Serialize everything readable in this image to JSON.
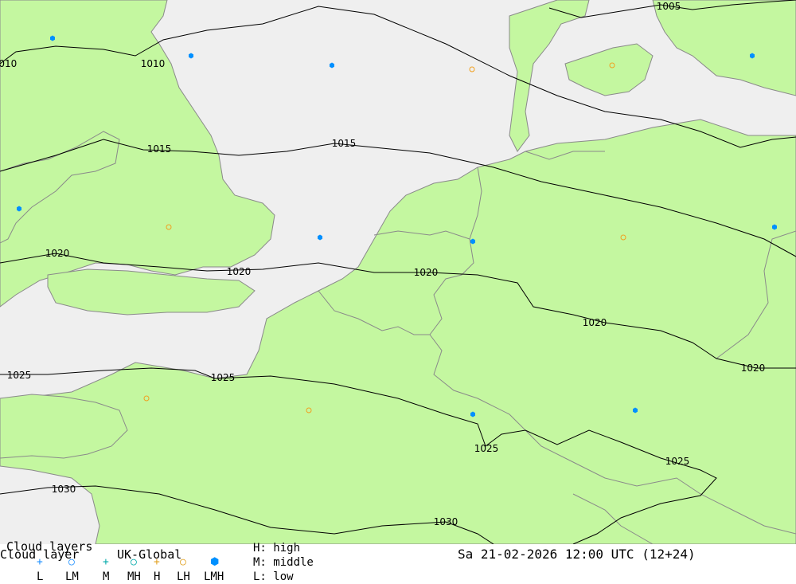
{
  "map": {
    "isobars": [
      {
        "value": "1010",
        "label": "1010",
        "points": [
          [
            0,
            80
          ],
          [
            20,
            65
          ],
          [
            70,
            58
          ],
          [
            130,
            62
          ],
          [
            170,
            70
          ],
          [
            205,
            50
          ],
          [
            260,
            38
          ],
          [
            330,
            30
          ],
          [
            400,
            8
          ],
          [
            470,
            18
          ],
          [
            560,
            55
          ],
          [
            640,
            95
          ],
          [
            700,
            120
          ],
          [
            760,
            140
          ],
          [
            830,
            150
          ],
          [
            880,
            165
          ],
          [
            930,
            185
          ],
          [
            970,
            175
          ],
          [
            1000,
            172
          ]
        ]
      },
      {
        "value": "1005",
        "label": "1005",
        "points": [
          [
            690,
            10
          ],
          [
            730,
            22
          ],
          [
            780,
            14
          ],
          [
            830,
            6
          ],
          [
            870,
            12
          ],
          [
            920,
            6
          ],
          [
            970,
            2
          ],
          [
            1000,
            0
          ]
        ]
      },
      {
        "value": "1015",
        "label": "1015",
        "points": [
          [
            0,
            215
          ],
          [
            70,
            195
          ],
          [
            130,
            175
          ],
          [
            180,
            188
          ],
          [
            240,
            190
          ],
          [
            300,
            195
          ],
          [
            360,
            190
          ],
          [
            420,
            180
          ],
          [
            470,
            185
          ],
          [
            540,
            192
          ],
          [
            620,
            210
          ],
          [
            680,
            228
          ],
          [
            760,
            245
          ],
          [
            830,
            260
          ],
          [
            900,
            280
          ],
          [
            960,
            300
          ],
          [
            1000,
            322
          ]
        ]
      },
      {
        "value": "1020",
        "label": "1020",
        "points": [
          [
            0,
            330
          ],
          [
            70,
            318
          ],
          [
            130,
            330
          ],
          [
            200,
            335
          ],
          [
            260,
            340
          ],
          [
            330,
            338
          ],
          [
            400,
            330
          ],
          [
            470,
            342
          ],
          [
            540,
            342
          ],
          [
            600,
            345
          ],
          [
            650,
            355
          ],
          [
            670,
            385
          ],
          [
            720,
            395
          ],
          [
            760,
            405
          ],
          [
            830,
            415
          ],
          [
            870,
            430
          ],
          [
            900,
            450
          ],
          [
            950,
            462
          ],
          [
            1000,
            462
          ]
        ]
      },
      {
        "value": "1025",
        "label": "1025",
        "points": [
          [
            0,
            470
          ],
          [
            60,
            470
          ],
          [
            130,
            465
          ],
          [
            190,
            462
          ],
          [
            245,
            465
          ],
          [
            270,
            475
          ],
          [
            340,
            472
          ],
          [
            420,
            482
          ],
          [
            500,
            500
          ],
          [
            560,
            520
          ],
          [
            600,
            532
          ],
          [
            610,
            560
          ],
          [
            630,
            545
          ],
          [
            660,
            540
          ],
          [
            700,
            558
          ],
          [
            740,
            540
          ],
          [
            780,
            555
          ],
          [
            830,
            575
          ],
          [
            880,
            590
          ],
          [
            900,
            600
          ],
          [
            880,
            622
          ],
          [
            830,
            632
          ],
          [
            780,
            650
          ],
          [
            750,
            670
          ],
          [
            720,
            683
          ]
        ]
      },
      {
        "value": "1030",
        "label": "1030",
        "points": [
          [
            0,
            620
          ],
          [
            60,
            612
          ],
          [
            120,
            610
          ],
          [
            200,
            620
          ],
          [
            270,
            640
          ],
          [
            340,
            662
          ],
          [
            420,
            670
          ],
          [
            480,
            660
          ],
          [
            560,
            655
          ],
          [
            600,
            670
          ],
          [
            620,
            683
          ]
        ]
      }
    ],
    "isobar_labels": [
      {
        "text": "1010",
        "at": [
          192,
          80
        ]
      },
      {
        "text": "1010",
        "at": [
          6,
          80
        ]
      },
      {
        "text": "1005",
        "at": [
          840,
          8
        ]
      },
      {
        "text": "1015",
        "at": [
          200,
          187
        ]
      },
      {
        "text": "1015",
        "at": [
          432,
          180
        ]
      },
      {
        "text": "1020",
        "at": [
          72,
          318
        ]
      },
      {
        "text": "1020",
        "at": [
          300,
          341
        ]
      },
      {
        "text": "1020",
        "at": [
          535,
          342
        ]
      },
      {
        "text": "1020",
        "at": [
          747,
          405
        ]
      },
      {
        "text": "1020",
        "at": [
          946,
          462
        ]
      },
      {
        "text": "1025",
        "at": [
          24,
          471
        ]
      },
      {
        "text": "1025",
        "at": [
          280,
          474
        ]
      },
      {
        "text": "1025",
        "at": [
          611,
          563
        ]
      },
      {
        "text": "1025",
        "at": [
          851,
          579
        ]
      },
      {
        "text": "1030",
        "at": [
          80,
          614
        ]
      },
      {
        "text": "1030",
        "at": [
          560,
          655
        ]
      }
    ],
    "cloud_symbols": [
      {
        "type": "LMH",
        "at": [
          66,
          48
        ]
      },
      {
        "type": "LMH",
        "at": [
          240,
          70
        ]
      },
      {
        "type": "LMH",
        "at": [
          417,
          82
        ]
      },
      {
        "type": "LH",
        "at": [
          593,
          87
        ]
      },
      {
        "type": "LH",
        "at": [
          769,
          82
        ]
      },
      {
        "type": "LMH",
        "at": [
          945,
          70
        ]
      },
      {
        "type": "LMH",
        "at": [
          24,
          262
        ]
      },
      {
        "type": "LH",
        "at": [
          212,
          285
        ]
      },
      {
        "type": "LMH",
        "at": [
          402,
          298
        ]
      },
      {
        "type": "LMH",
        "at": [
          594,
          303
        ]
      },
      {
        "type": "LH",
        "at": [
          783,
          298
        ]
      },
      {
        "type": "LMH",
        "at": [
          973,
          285
        ]
      },
      {
        "type": "LH",
        "at": [
          184,
          500
        ]
      },
      {
        "type": "LH",
        "at": [
          388,
          515
        ]
      },
      {
        "type": "LMH",
        "at": [
          594,
          520
        ]
      },
      {
        "type": "LMH",
        "at": [
          798,
          515
        ]
      }
    ]
  },
  "legend": {
    "title_line1": "Cloud layers",
    "title_line2": "Cloud layer",
    "model": "UK-Global",
    "datetime": "Sa 21-02-2026 12:00 UTC (12+24)",
    "levels": [
      {
        "text": "H: high"
      },
      {
        "text": "M: middle"
      },
      {
        "text": "L: low"
      }
    ],
    "symbol_keys": [
      {
        "label": "L",
        "symbol": "+",
        "color": "#1e90ff"
      },
      {
        "label": "LM",
        "symbol": "○",
        "color": "#1e90ff"
      },
      {
        "label": "M",
        "symbol": "+",
        "color": "#00a8a8"
      },
      {
        "label": "MH",
        "symbol": "○",
        "color": "#00a8a8"
      },
      {
        "label": "H",
        "symbol": "+",
        "color": "#e0a020"
      },
      {
        "label": "LH",
        "symbol": "○",
        "color": "#e0a020"
      },
      {
        "label": "LMH",
        "symbol": "⬢",
        "color": "#0090ff"
      }
    ]
  },
  "colors": {
    "land": "#c4f7a0",
    "sea": "#efefef",
    "border": "#8a8a8a",
    "isobar": "#000000",
    "lmh": "#0090ff",
    "lh": "#f0a020"
  }
}
